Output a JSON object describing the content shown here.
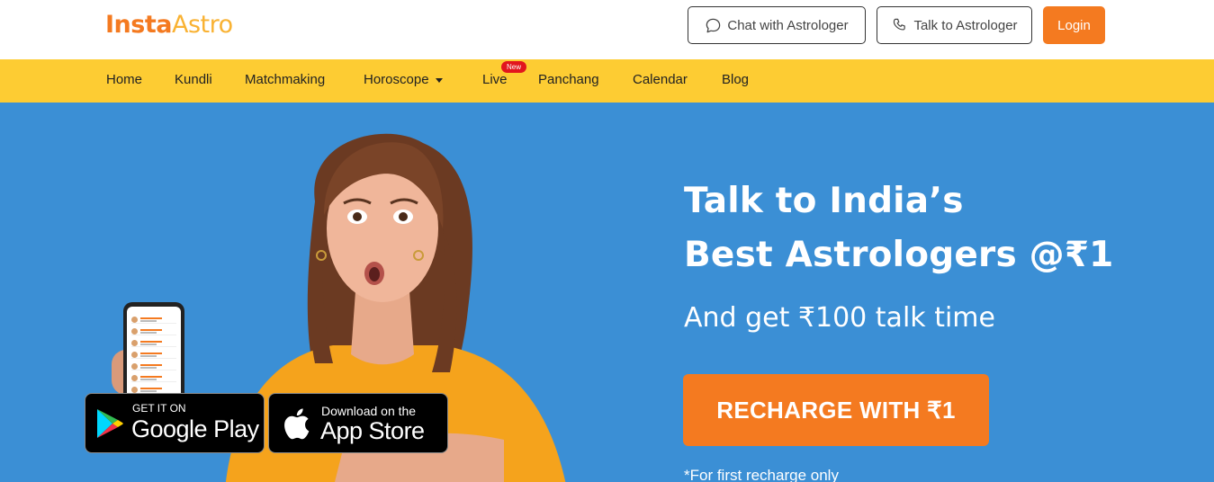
{
  "header": {
    "logo_part1": "Insta",
    "logo_part2": "Astro",
    "chat_button": "Chat with Astrologer",
    "talk_button": "Talk to Astrologer",
    "login_button": "Login"
  },
  "nav": {
    "items": [
      {
        "label": "Home"
      },
      {
        "label": "Kundli"
      },
      {
        "label": "Matchmaking"
      },
      {
        "label": "Horoscope"
      },
      {
        "label": "Live"
      },
      {
        "label": "Panchang"
      },
      {
        "label": "Calendar"
      },
      {
        "label": "Blog"
      }
    ],
    "live_badge": "New"
  },
  "hero": {
    "title_line1": "Talk to India’s",
    "title_line2": "Best Astrologers @₹1",
    "subtitle": "And get ₹100 talk time",
    "cta": "RECHARGE WITH ₹1",
    "footnote": "*For first recharge only",
    "google_play_small": "GET IT ON",
    "google_play_big": "Google Play",
    "app_store_small": "Download on the",
    "app_store_big": "App Store"
  },
  "colors": {
    "brand_orange": "#f47a20",
    "nav_yellow": "#fdcc33",
    "hero_blue": "#3b8fd5"
  }
}
